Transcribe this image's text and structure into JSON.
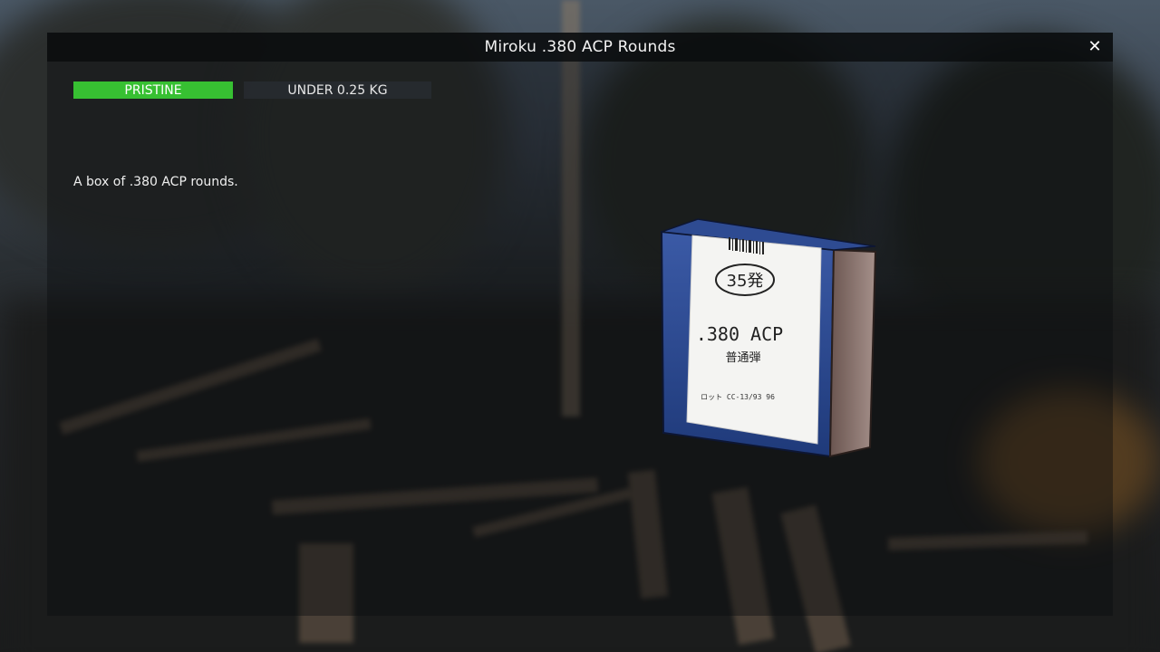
{
  "window": {
    "title": "Miroku .380 ACP Rounds",
    "close_icon": "close-icon",
    "close_glyph": "✕"
  },
  "item": {
    "condition": "PRISTINE",
    "condition_color": "#37c032",
    "weight": "UNDER 0.25 KG",
    "description": "A box of .380 ACP rounds.",
    "box_label": {
      "count": "35発",
      "caliber": ".380 ACP",
      "type": "普通弾",
      "lot": "ロット CC-13/93 96"
    }
  }
}
